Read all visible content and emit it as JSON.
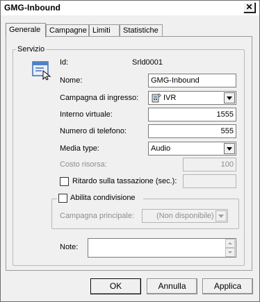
{
  "window": {
    "title": "GMG-Inbound",
    "close_label": "✕"
  },
  "tabs": [
    {
      "label": "Generale",
      "active": true
    },
    {
      "label": "Campagne",
      "active": false
    },
    {
      "label": "Limiti",
      "active": false
    },
    {
      "label": "Statistiche",
      "active": false
    }
  ],
  "servizio": {
    "legend": "Servizio",
    "icon": "service-window-icon",
    "id_label": "Id:",
    "id_value": "Srld0001",
    "nome_label": "Nome:",
    "nome_value": "GMG-Inbound",
    "campagna_label": "Campagna di ingresso:",
    "campagna_value": "IVR",
    "campagna_icon": "ivr-phone-icon",
    "interno_label": "Interno virtuale:",
    "interno_value": "1555",
    "numero_label": "Numero di telefono:",
    "numero_value": "555",
    "media_label": "Media type:",
    "media_value": "Audio",
    "costo_label": "Costo risorsa:",
    "costo_value": "100",
    "ritardo_label": "Ritardo sulla tassazione (sec.):",
    "ritardo_value": "",
    "condivisione_label": "Abilita condivisione",
    "campagna_principale_label": "Campagna principale:",
    "campagna_principale_value": "(Non disponibile)",
    "note_label": "Note:",
    "note_value": ""
  },
  "buttons": {
    "ok": "OK",
    "annulla": "Annulla",
    "applica": "Applica"
  }
}
